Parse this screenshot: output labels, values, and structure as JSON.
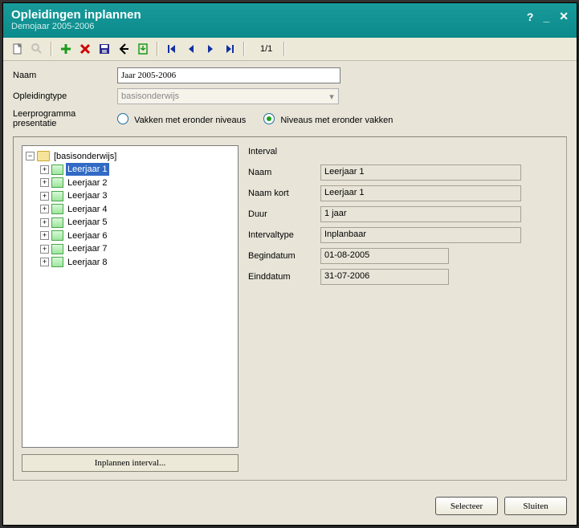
{
  "window": {
    "title": "Opleidingen inplannen",
    "subtitle": "Demojaar 2005-2006"
  },
  "toolbar": {
    "page_indicator": "1/1"
  },
  "form": {
    "naam_label": "Naam",
    "naam_value": "Jaar 2005-2006",
    "opltype_label": "Opleidingtype",
    "opltype_value": "basisonderwijs",
    "leerprog_label_line1": "Leerprogramma",
    "leerprog_label_line2": "presentatie",
    "radio_vakken": "Vakken met eronder niveaus",
    "radio_niveaus": "Niveaus met eronder vakken",
    "radio_selected": "niveaus"
  },
  "tree": {
    "root_label": "[basisonderwijs]",
    "items": [
      {
        "label": "Leerjaar 1",
        "selected": true
      },
      {
        "label": "Leerjaar 2"
      },
      {
        "label": "Leerjaar 3"
      },
      {
        "label": "Leerjaar 4"
      },
      {
        "label": "Leerjaar 5"
      },
      {
        "label": "Leerjaar 6"
      },
      {
        "label": "Leerjaar 7"
      },
      {
        "label": "Leerjaar 8"
      }
    ],
    "inplan_button": "Inplannen interval..."
  },
  "detail": {
    "section": "Interval",
    "naam_label": "Naam",
    "naam_value": "Leerjaar 1",
    "naamkort_label": "Naam kort",
    "naamkort_value": "Leerjaar 1",
    "duur_label": "Duur",
    "duur_value": "1 jaar",
    "type_label": "Intervaltype",
    "type_value": "Inplanbaar",
    "begin_label": "Begindatum",
    "begin_value": "01-08-2005",
    "eind_label": "Einddatum",
    "eind_value": "31-07-2006"
  },
  "footer": {
    "select": "Selecteer",
    "close": "Sluiten"
  }
}
